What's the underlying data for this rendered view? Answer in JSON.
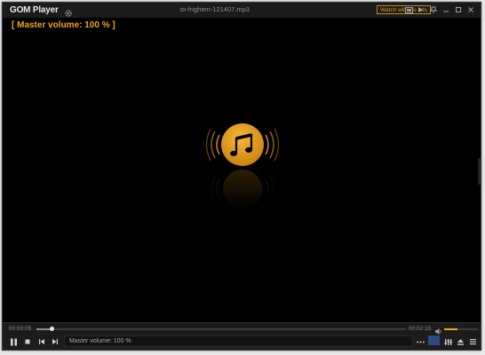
{
  "app": {
    "name": "GOM Player",
    "file_title": "to-frighten-121407.mp3",
    "ad_badge": "Watch with no ads"
  },
  "osd": {
    "message": "[ Master volume: 100 % ]"
  },
  "playback": {
    "current_time": "00:00:05",
    "total_time": "00:02:15",
    "progress_fraction": 0.04,
    "volume_fraction": 0.4,
    "status_text": "Master volume: 100 %"
  },
  "colors": {
    "accent": "#f0a41c",
    "background": "#000000",
    "bar": "#1c1c1c"
  },
  "icons": {
    "titlebar": [
      "settings-gear-icon",
      "screen-ratio-icon",
      "playlist-play-icon",
      "pin-icon",
      "minimize-icon",
      "maximize-icon",
      "close-icon"
    ],
    "controls": [
      "pause-icon",
      "stop-icon",
      "previous-icon",
      "next-icon",
      "more-icon",
      "subtitle-icon",
      "equalizer-icon",
      "eject-icon",
      "menu-icon"
    ]
  }
}
